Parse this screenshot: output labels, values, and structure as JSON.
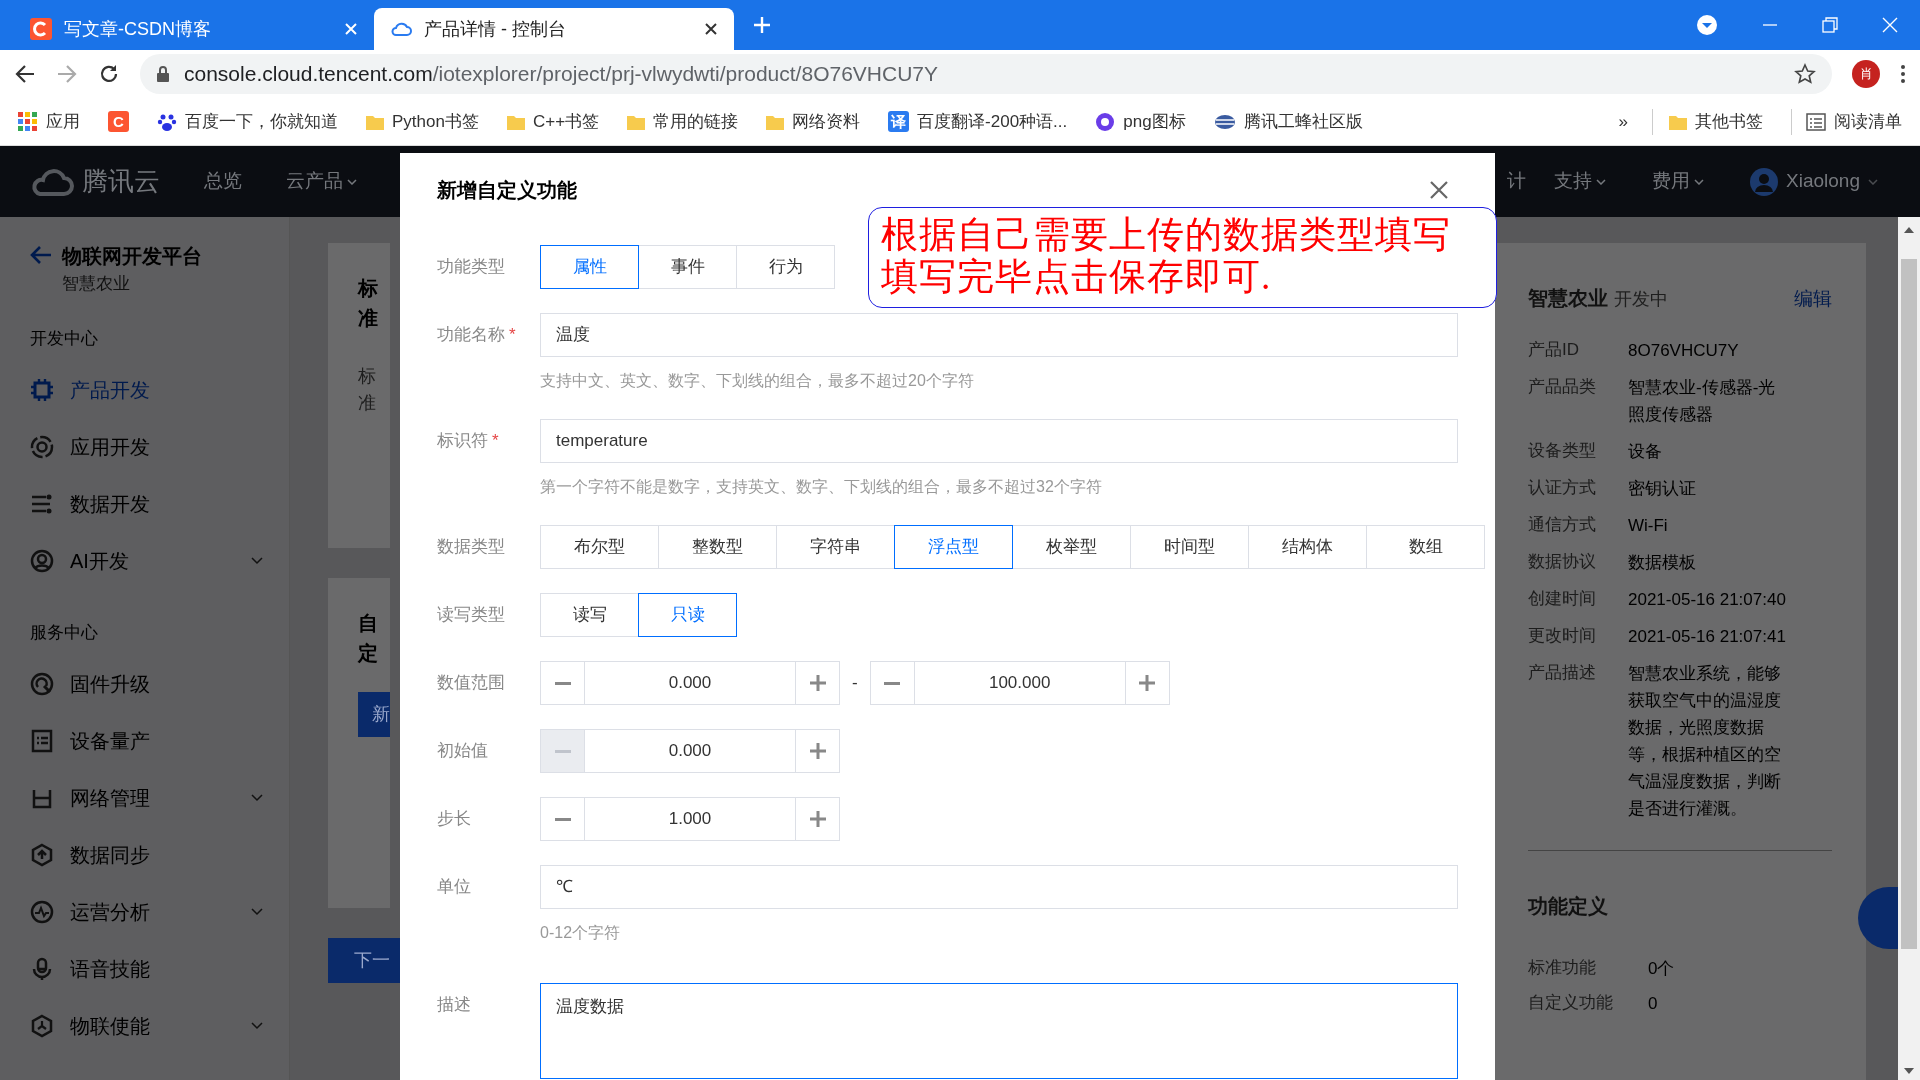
{
  "browser": {
    "tabs": [
      {
        "title": "写文章-CSDN博客",
        "selected": false
      },
      {
        "title": "产品详情 - 控制台",
        "selected": true
      }
    ],
    "url_host": "console.cloud.tencent.com",
    "url_path": "/iotexplorer/project/prj-vlwydwti/product/8O76VHCU7Y",
    "avatar": "肖",
    "bookmarks": [
      {
        "kind": "apps",
        "label": "应用"
      },
      {
        "kind": "csdn",
        "icon_text": "C"
      },
      {
        "kind": "paw",
        "label": "百度一下，你就知道"
      },
      {
        "kind": "folder",
        "label": "Python书签"
      },
      {
        "kind": "folder",
        "label": "C++书签"
      },
      {
        "kind": "folder",
        "label": "常用的链接"
      },
      {
        "kind": "folder",
        "label": "网络资料"
      },
      {
        "kind": "translate",
        "icon_text": "译",
        "label": "百度翻译-200种语..."
      },
      {
        "kind": "swirl",
        "label": "png图标"
      },
      {
        "kind": "bee",
        "label": "腾讯工蜂社区版"
      }
    ],
    "overflow": "»",
    "other_bookmarks": "其他书签",
    "reading_list": "阅读清单"
  },
  "navbar": {
    "logo": "腾讯云",
    "menus": [
      {
        "label": "总览",
        "dropdown": false
      },
      {
        "label": "云产品",
        "dropdown": true
      }
    ],
    "right_menus": [
      {
        "label": "计",
        "dropdown": false
      },
      {
        "label": "支持",
        "dropdown": true
      },
      {
        "label": "费用",
        "dropdown": true
      }
    ],
    "user": "Xiaolong"
  },
  "sidebar": {
    "title": "物联网开发平台",
    "subtitle": "智慧农业",
    "sections": [
      {
        "heading": "开发中心",
        "items": [
          {
            "label": "产品开发",
            "selected": true,
            "expandable": false
          },
          {
            "label": "应用开发",
            "selected": false,
            "expandable": false
          },
          {
            "label": "数据开发",
            "selected": false,
            "expandable": false
          },
          {
            "label": "AI开发",
            "selected": false,
            "expandable": true
          }
        ]
      },
      {
        "heading": "服务中心",
        "items": [
          {
            "label": "固件升级",
            "selected": false,
            "expandable": false
          },
          {
            "label": "设备量产",
            "selected": false,
            "expandable": false
          },
          {
            "label": "网络管理",
            "selected": false,
            "expandable": true
          },
          {
            "label": "数据同步",
            "selected": false,
            "expandable": false
          },
          {
            "label": "运营分析",
            "selected": false,
            "expandable": true
          },
          {
            "label": "语音技能",
            "selected": false,
            "expandable": false
          },
          {
            "label": "物联使能",
            "selected": false,
            "expandable": true
          }
        ]
      }
    ]
  },
  "background_cards": [
    {
      "title": "标准",
      "subtitle": "标准"
    },
    {
      "title": "自定",
      "button": "新"
    }
  ],
  "next_button": "下一",
  "product": {
    "name": "智慧农业",
    "status": "开发中",
    "edit": "编辑",
    "rows": [
      {
        "label": "产品ID",
        "value": "8O76VHCU7Y"
      },
      {
        "label": "产品品类",
        "value": "智慧农业-传感器-光照度传感器"
      },
      {
        "label": "设备类型",
        "value": "设备"
      },
      {
        "label": "认证方式",
        "value": "密钥认证"
      },
      {
        "label": "通信方式",
        "value": "Wi-Fi"
      },
      {
        "label": "数据协议",
        "value": "数据模板"
      },
      {
        "label": "创建时间",
        "value": "2021-05-16 21:07:40"
      },
      {
        "label": "更改时间",
        "value": "2021-05-16 21:07:41"
      },
      {
        "label": "产品描述",
        "value": "智慧农业系统，能够获取空气中的温湿度数据，光照度数据等，根据种植区的空气温湿度数据，判断是否进行灌溉。"
      }
    ],
    "section": "功能定义",
    "counts": [
      {
        "label": "标准功能",
        "value": "0个"
      },
      {
        "label": "自定义功能",
        "value": "0"
      }
    ]
  },
  "modal": {
    "title": "新增自定义功能",
    "fields": [
      {
        "kind": "segmented",
        "label": "功能类型",
        "options": [
          {
            "label": "属性",
            "selected": true
          },
          {
            "label": "事件",
            "selected": false
          },
          {
            "label": "行为",
            "selected": false
          }
        ]
      },
      {
        "kind": "text",
        "label": "功能名称",
        "required_mark": "*",
        "value": "温度",
        "hint": "支持中文、英文、数字、下划线的组合，最多不超过20个字符"
      },
      {
        "kind": "text",
        "label": "标识符",
        "required_mark": "*",
        "value": "temperature",
        "hint": "第一个字符不能是数字，支持英文、数字、下划线的组合，最多不超过32个字符"
      },
      {
        "kind": "segmented",
        "label": "数据类型",
        "options": [
          {
            "label": "布尔型",
            "selected": false
          },
          {
            "label": "整数型",
            "selected": false
          },
          {
            "label": "字符串",
            "selected": false
          },
          {
            "label": "浮点型",
            "selected": true
          },
          {
            "label": "枚举型",
            "selected": false
          },
          {
            "label": "时间型",
            "selected": false
          },
          {
            "label": "结构体",
            "selected": false
          },
          {
            "label": "数组",
            "selected": false
          }
        ]
      },
      {
        "kind": "segmented",
        "label": "读写类型",
        "options": [
          {
            "label": "读写",
            "selected": false
          },
          {
            "label": "只读",
            "selected": true
          }
        ]
      },
      {
        "kind": "range",
        "label": "数值范围",
        "separator": "-",
        "steppers": [
          {
            "value": "0.000",
            "minus_disabled": false
          },
          {
            "value": "100.000",
            "minus_disabled": false
          }
        ]
      },
      {
        "kind": "stepper",
        "label": "初始值",
        "steppers": [
          {
            "value": "0.000",
            "minus_disabled": true
          }
        ]
      },
      {
        "kind": "stepper",
        "label": "步长",
        "steppers": [
          {
            "value": "1.000",
            "minus_disabled": false
          }
        ]
      },
      {
        "kind": "text",
        "label": "单位",
        "value": "℃",
        "hint": "0-12个字符"
      },
      {
        "kind": "textarea",
        "label": "描述",
        "value": "温度数据",
        "focused": true
      }
    ]
  },
  "annotation": {
    "lines": [
      "根据自己需要上传的数据类型填写",
      "填写完毕点击保存即可."
    ]
  }
}
